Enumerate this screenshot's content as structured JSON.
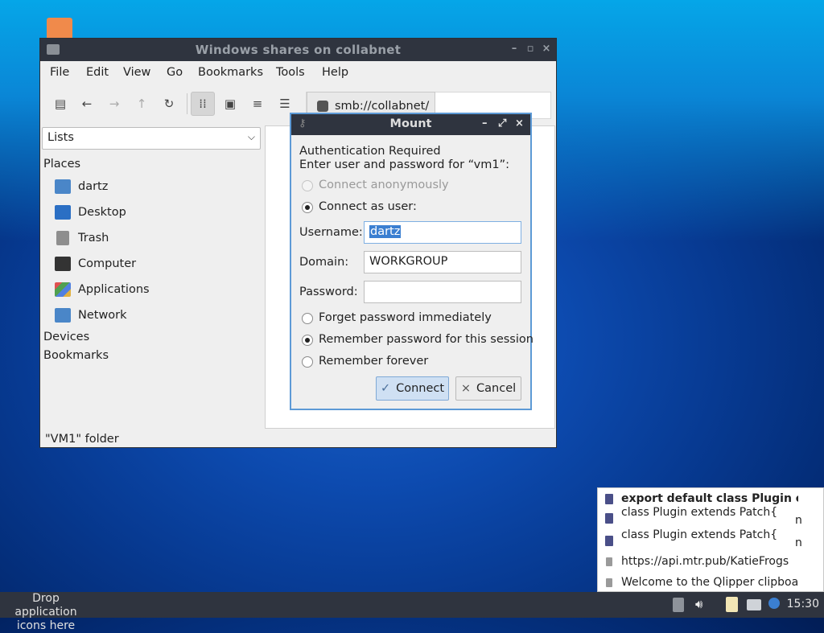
{
  "window": {
    "title": "Windows shares on collabnet",
    "menu": [
      "File",
      "Edit",
      "View",
      "Go",
      "Bookmarks",
      "Tools",
      "Help"
    ],
    "path": "smb://collabnet/",
    "status": "\"VM1\" folder"
  },
  "sidebar": {
    "mode": "Lists",
    "places_label": "Places",
    "places": [
      "dartz",
      "Desktop",
      "Trash",
      "Computer",
      "Applications",
      "Network"
    ],
    "devices_label": "Devices",
    "bookmarks_label": "Bookmarks"
  },
  "dialog": {
    "title": "Mount",
    "heading": "Authentication Required",
    "prompt": "Enter user and password for “vm1”:",
    "anon_label": "Connect anonymously",
    "user_label": "Connect as user:",
    "username_label": "Username:",
    "username_value": "dartz",
    "domain_label": "Domain:",
    "domain_value": "WORKGROUP",
    "password_label": "Password:",
    "password_value": "",
    "opt_forget": "Forget password immediately",
    "opt_session": "Remember password for this session",
    "opt_forever": "Remember forever",
    "connect": "Connect",
    "cancel": "Cancel"
  },
  "clipboard": {
    "items": [
      "export default class Plugin ex",
      "class Plugin extends Patch{",
      "class Plugin extends Patch{",
      "https://api.mtr.pub/KatieFrogs",
      "Welcome to the Qlipper clipboa"
    ],
    "extra": "n"
  },
  "taskbar": {
    "drop_line1": "Drop application",
    "drop_line2": "icons here",
    "clock": "15:30"
  },
  "colors": {
    "titlebar": "#2f343f",
    "accent": "#5d9ad6",
    "selection": "#3b7fd1"
  }
}
